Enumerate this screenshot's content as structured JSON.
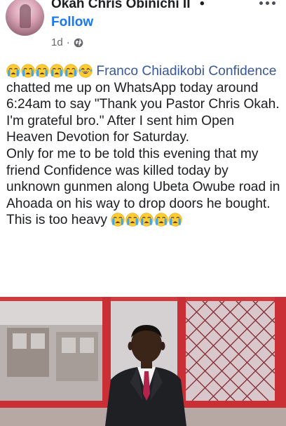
{
  "post": {
    "author": "Okah Chris Obinichi II",
    "separator": "•",
    "follow_label": "Follow",
    "time": "1d",
    "body": {
      "tagged_name": "Franco Chiadikobi Confidence",
      "text_after_tag": " chatted me up on WhatsApp today around 6:24am to say \"Thank you Pastor Chris Okah. I'm grateful bro.\" After I sent him Open Heaven Devotion for Saturday.",
      "paragraph2": "Only for me to be told this evening that my friend Confidence was killed today by unknown gunmen along Ubeta Owube road in Ahoada on his way to drop doors he bought.",
      "paragraph3": "This is too heavy"
    }
  },
  "icons": {
    "avatar": "profile-photo",
    "globe": "globe-icon",
    "more": "more-options-icon",
    "crying": "loudly-crying-face-emoji",
    "laughing": "face-with-tears-of-joy-emoji"
  },
  "colors": {
    "link": "#385898",
    "follow": "#1877f2",
    "meta": "#65676b",
    "text": "#1c1e21"
  }
}
